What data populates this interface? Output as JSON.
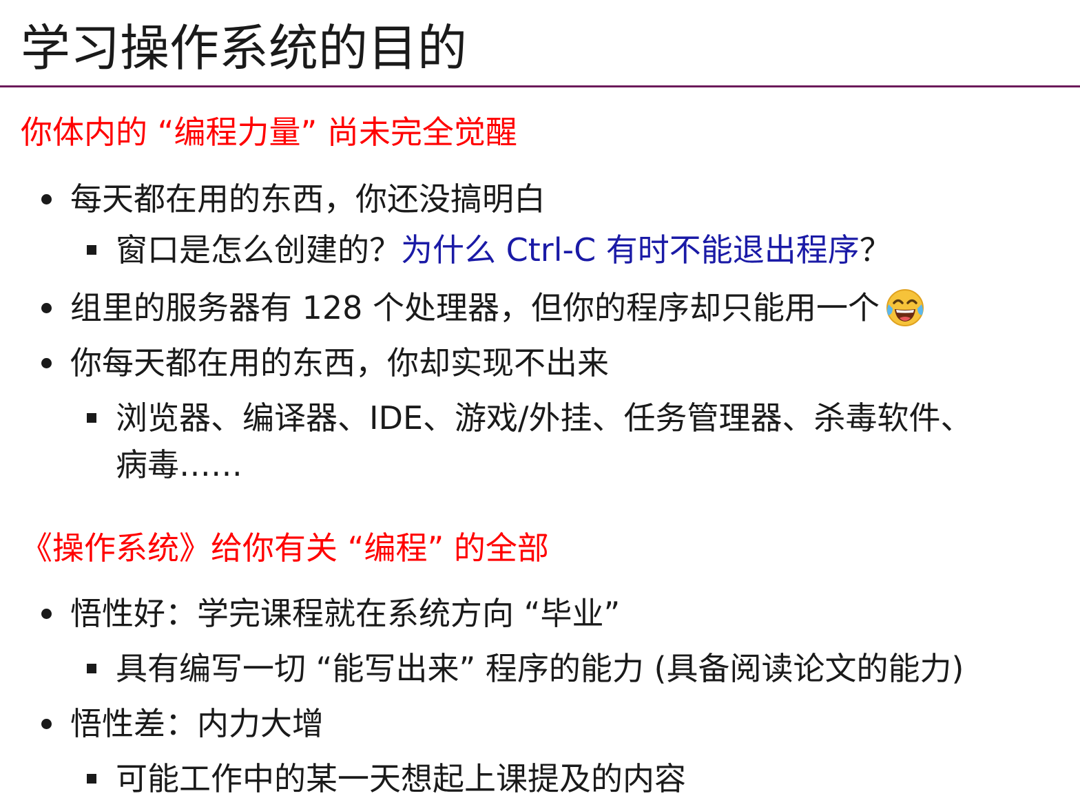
{
  "slide": {
    "title": "学习操作系统的目的"
  },
  "section1": {
    "heading": "你体内的 “编程力量” 尚未完全觉醒",
    "items": [
      {
        "text": "每天都在用的东西，你还没搞明白"
      },
      {
        "text_plain": "窗口是怎么创建的？",
        "text_blue": "为什么 Ctrl-C 有时不能退出程序",
        "text_end": "？"
      },
      {
        "text": "组里的服务器有 128 个处理器，但你的程序却只能用一个",
        "emoji": "face-with-tears-of-joy-icon"
      },
      {
        "text": "你每天都在用的东西，你却实现不出来"
      },
      {
        "line1": "浏览器、编译器、IDE、游戏/外挂、任务管理器、杀毒软件、",
        "line2": "病毒……"
      }
    ]
  },
  "section2": {
    "heading": "《操作系统》给你有关 “编程” 的全部",
    "items": [
      {
        "text": "悟性好：学完课程就在系统方向 “毕业”"
      },
      {
        "text": "具有编写一切 “能写出来” 程序的能力 (具备阅读论文的能力)"
      },
      {
        "text": "悟性差：内力大增"
      },
      {
        "text": "可能工作中的某一天想起上课提及的内容"
      }
    ]
  },
  "colors": {
    "heading_red": "#ff0000",
    "link_blue": "#1a1aa6",
    "rule_purple": "#6b1a5a",
    "text": "#1a1a1a"
  }
}
